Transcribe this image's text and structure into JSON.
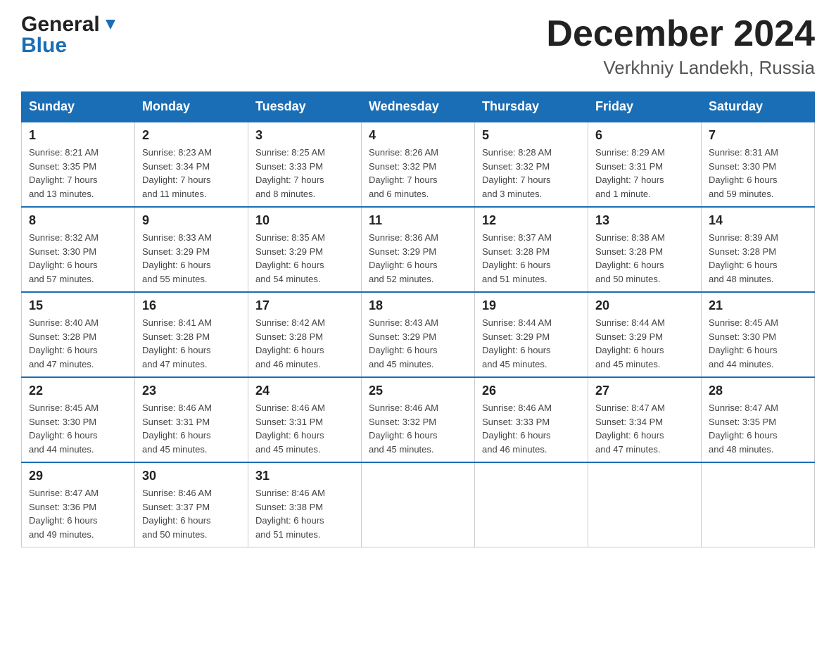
{
  "header": {
    "logo_general": "General",
    "logo_blue": "Blue",
    "month_year": "December 2024",
    "location": "Verkhniy Landekh, Russia"
  },
  "calendar": {
    "headers": [
      "Sunday",
      "Monday",
      "Tuesday",
      "Wednesday",
      "Thursday",
      "Friday",
      "Saturday"
    ],
    "weeks": [
      [
        {
          "day": "1",
          "info": "Sunrise: 8:21 AM\nSunset: 3:35 PM\nDaylight: 7 hours\nand 13 minutes."
        },
        {
          "day": "2",
          "info": "Sunrise: 8:23 AM\nSunset: 3:34 PM\nDaylight: 7 hours\nand 11 minutes."
        },
        {
          "day": "3",
          "info": "Sunrise: 8:25 AM\nSunset: 3:33 PM\nDaylight: 7 hours\nand 8 minutes."
        },
        {
          "day": "4",
          "info": "Sunrise: 8:26 AM\nSunset: 3:32 PM\nDaylight: 7 hours\nand 6 minutes."
        },
        {
          "day": "5",
          "info": "Sunrise: 8:28 AM\nSunset: 3:32 PM\nDaylight: 7 hours\nand 3 minutes."
        },
        {
          "day": "6",
          "info": "Sunrise: 8:29 AM\nSunset: 3:31 PM\nDaylight: 7 hours\nand 1 minute."
        },
        {
          "day": "7",
          "info": "Sunrise: 8:31 AM\nSunset: 3:30 PM\nDaylight: 6 hours\nand 59 minutes."
        }
      ],
      [
        {
          "day": "8",
          "info": "Sunrise: 8:32 AM\nSunset: 3:30 PM\nDaylight: 6 hours\nand 57 minutes."
        },
        {
          "day": "9",
          "info": "Sunrise: 8:33 AM\nSunset: 3:29 PM\nDaylight: 6 hours\nand 55 minutes."
        },
        {
          "day": "10",
          "info": "Sunrise: 8:35 AM\nSunset: 3:29 PM\nDaylight: 6 hours\nand 54 minutes."
        },
        {
          "day": "11",
          "info": "Sunrise: 8:36 AM\nSunset: 3:29 PM\nDaylight: 6 hours\nand 52 minutes."
        },
        {
          "day": "12",
          "info": "Sunrise: 8:37 AM\nSunset: 3:28 PM\nDaylight: 6 hours\nand 51 minutes."
        },
        {
          "day": "13",
          "info": "Sunrise: 8:38 AM\nSunset: 3:28 PM\nDaylight: 6 hours\nand 50 minutes."
        },
        {
          "day": "14",
          "info": "Sunrise: 8:39 AM\nSunset: 3:28 PM\nDaylight: 6 hours\nand 48 minutes."
        }
      ],
      [
        {
          "day": "15",
          "info": "Sunrise: 8:40 AM\nSunset: 3:28 PM\nDaylight: 6 hours\nand 47 minutes."
        },
        {
          "day": "16",
          "info": "Sunrise: 8:41 AM\nSunset: 3:28 PM\nDaylight: 6 hours\nand 47 minutes."
        },
        {
          "day": "17",
          "info": "Sunrise: 8:42 AM\nSunset: 3:28 PM\nDaylight: 6 hours\nand 46 minutes."
        },
        {
          "day": "18",
          "info": "Sunrise: 8:43 AM\nSunset: 3:29 PM\nDaylight: 6 hours\nand 45 minutes."
        },
        {
          "day": "19",
          "info": "Sunrise: 8:44 AM\nSunset: 3:29 PM\nDaylight: 6 hours\nand 45 minutes."
        },
        {
          "day": "20",
          "info": "Sunrise: 8:44 AM\nSunset: 3:29 PM\nDaylight: 6 hours\nand 45 minutes."
        },
        {
          "day": "21",
          "info": "Sunrise: 8:45 AM\nSunset: 3:30 PM\nDaylight: 6 hours\nand 44 minutes."
        }
      ],
      [
        {
          "day": "22",
          "info": "Sunrise: 8:45 AM\nSunset: 3:30 PM\nDaylight: 6 hours\nand 44 minutes."
        },
        {
          "day": "23",
          "info": "Sunrise: 8:46 AM\nSunset: 3:31 PM\nDaylight: 6 hours\nand 45 minutes."
        },
        {
          "day": "24",
          "info": "Sunrise: 8:46 AM\nSunset: 3:31 PM\nDaylight: 6 hours\nand 45 minutes."
        },
        {
          "day": "25",
          "info": "Sunrise: 8:46 AM\nSunset: 3:32 PM\nDaylight: 6 hours\nand 45 minutes."
        },
        {
          "day": "26",
          "info": "Sunrise: 8:46 AM\nSunset: 3:33 PM\nDaylight: 6 hours\nand 46 minutes."
        },
        {
          "day": "27",
          "info": "Sunrise: 8:47 AM\nSunset: 3:34 PM\nDaylight: 6 hours\nand 47 minutes."
        },
        {
          "day": "28",
          "info": "Sunrise: 8:47 AM\nSunset: 3:35 PM\nDaylight: 6 hours\nand 48 minutes."
        }
      ],
      [
        {
          "day": "29",
          "info": "Sunrise: 8:47 AM\nSunset: 3:36 PM\nDaylight: 6 hours\nand 49 minutes."
        },
        {
          "day": "30",
          "info": "Sunrise: 8:46 AM\nSunset: 3:37 PM\nDaylight: 6 hours\nand 50 minutes."
        },
        {
          "day": "31",
          "info": "Sunrise: 8:46 AM\nSunset: 3:38 PM\nDaylight: 6 hours\nand 51 minutes."
        },
        {
          "day": "",
          "info": ""
        },
        {
          "day": "",
          "info": ""
        },
        {
          "day": "",
          "info": ""
        },
        {
          "day": "",
          "info": ""
        }
      ]
    ]
  }
}
